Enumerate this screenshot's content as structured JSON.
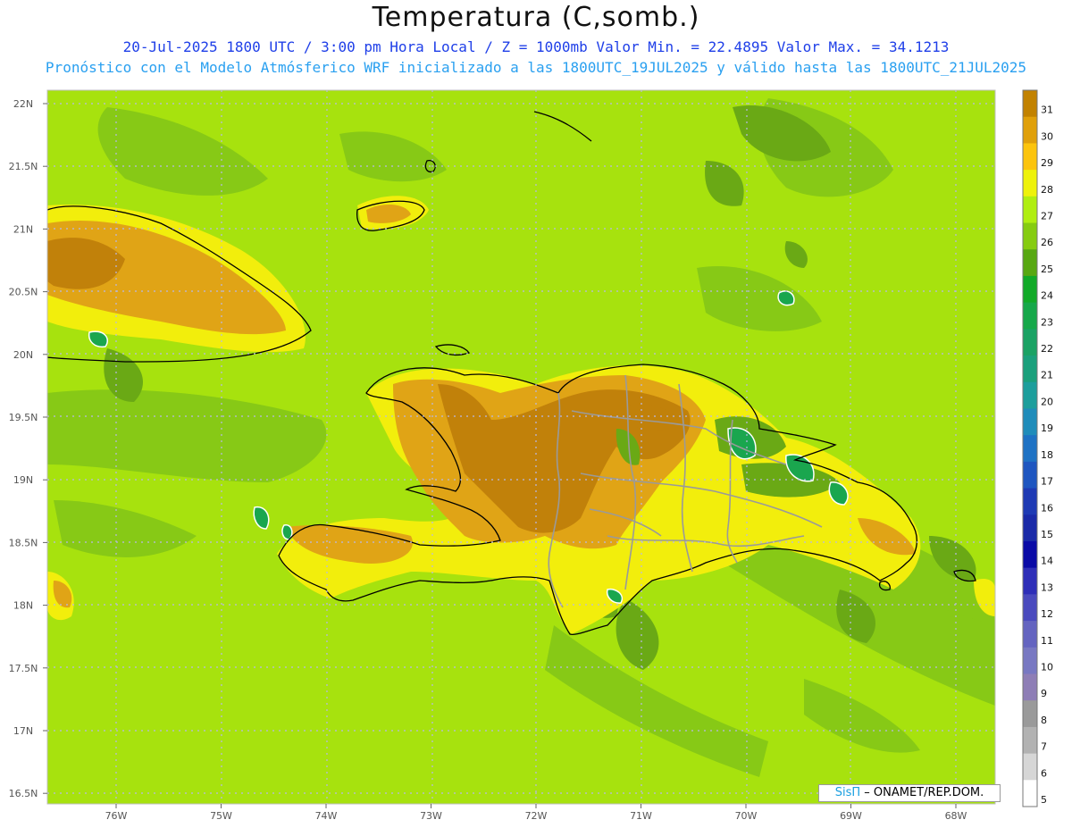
{
  "header": {
    "title": "Temperatura (C,somb.)",
    "line1": "20-Jul-2025  1800 UTC / 3:00 pm Hora Local / Z = 1000mb   Valor Min. = 22.4895  Valor Max. = 34.1213",
    "line2": "Pronóstico con el Modelo Atmósferico WRF inicializado a las 1800UTC_19JUL2025 y válido hasta las  1800UTC_21JUL2025"
  },
  "map": {
    "variable": "Temperatura",
    "units": "C",
    "level": "1000mb",
    "valid_time": "20-Jul-2025 1800 UTC",
    "min_value": 22.4895,
    "max_value": 34.1213,
    "lat_labels": [
      "22N",
      "21.5N",
      "21N",
      "20.5N",
      "20N",
      "19.5N",
      "19N",
      "18.5N",
      "18N",
      "17.5N",
      "17N",
      "16.5N"
    ],
    "lon_labels": [
      "76W",
      "75W",
      "74W",
      "73W",
      "72W",
      "71W",
      "70W",
      "69W",
      "68W"
    ],
    "lat_range": [
      16.5,
      22.0
    ],
    "lon_range": [
      -76.7,
      -67.6
    ],
    "grid": true
  },
  "legend": {
    "labels": [
      "5",
      "6",
      "7",
      "8",
      "9",
      "10",
      "11",
      "12",
      "13",
      "14",
      "15",
      "16",
      "17",
      "18",
      "19",
      "20",
      "21",
      "22",
      "23",
      "24",
      "25",
      "26",
      "27",
      "28",
      "29",
      "30",
      "31"
    ],
    "colors": [
      "#ffffff",
      "#d6d6d6",
      "#b2b2b2",
      "#9a9a9a",
      "#8e7eb6",
      "#7878c2",
      "#6464c0",
      "#4a4abe",
      "#2e2eb8",
      "#0a0aa6",
      "#1a2aa8",
      "#1e3ab4",
      "#1e56c0",
      "#1e72c4",
      "#1f8cba",
      "#1c9e9c",
      "#1aa07c",
      "#1aa264",
      "#16a84a",
      "#12aa28",
      "#58a812",
      "#86cc10",
      "#b0ee10",
      "#eef20a",
      "#fcc40c",
      "#e0a00a",
      "#c28200"
    ]
  },
  "credit": {
    "logo": "SisΠ",
    "org": "– ONAMET/REP.DOM."
  },
  "colors": {
    "base": "#a7e20e",
    "dark_green": "#87c916",
    "olive": "#6aa915",
    "yellow": "#f2ee0c",
    "orange": "#e0a416",
    "brown": "#c1810a",
    "deep_green": "#1aa64e",
    "grid": "#b8b8e8"
  }
}
